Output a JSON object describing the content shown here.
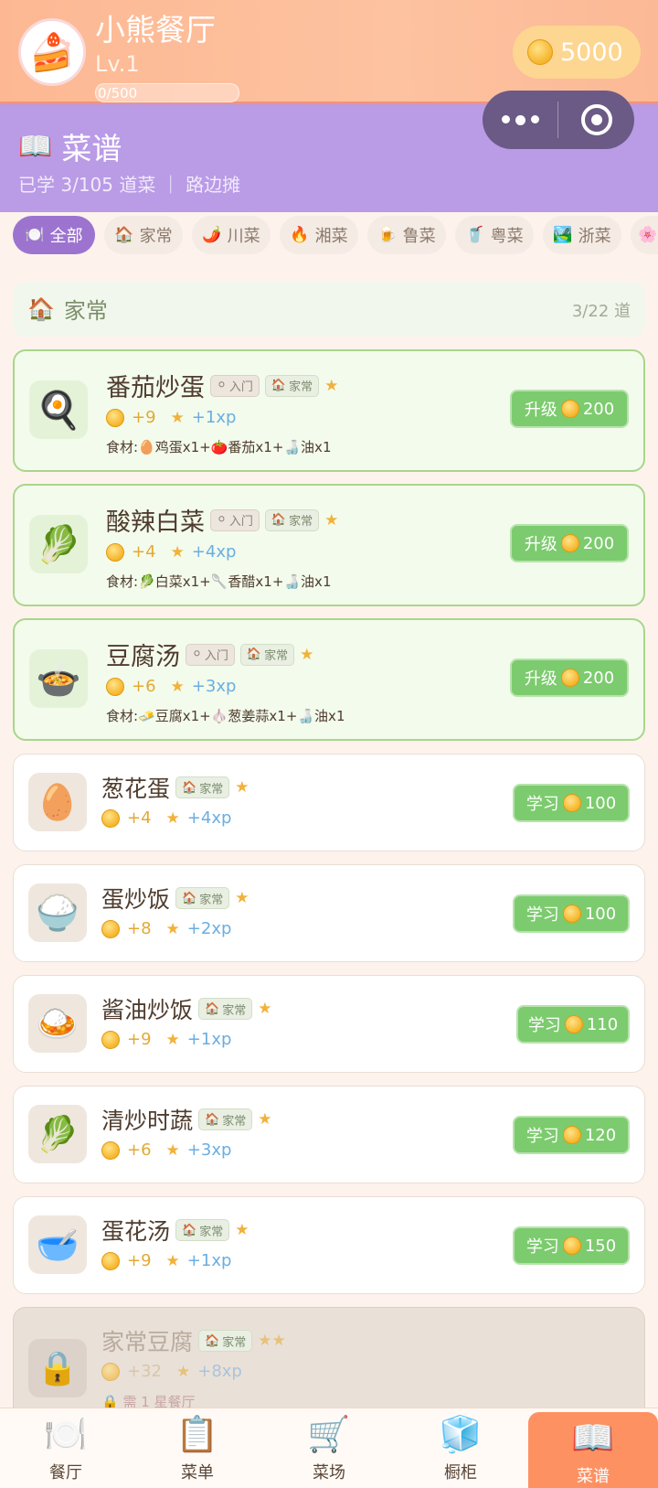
{
  "header": {
    "shop_name": "小熊餐厅",
    "level": "Lv.1",
    "exp_text": "0/500",
    "exp_progress": 0,
    "coins": "5000",
    "avatar_icon": "cake-icon"
  },
  "recipe_book": {
    "icon": "📖",
    "title": "菜谱",
    "subtitle": "已学 3/105 道菜 ｜ 路边摊"
  },
  "tabs": [
    {
      "emoji": "🍽️",
      "label": "全部",
      "active": true
    },
    {
      "emoji": "🏠",
      "label": "家常"
    },
    {
      "emoji": "🌶️",
      "label": "川菜"
    },
    {
      "emoji": "🔥",
      "label": "湘菜"
    },
    {
      "emoji": "🍺",
      "label": "鲁菜"
    },
    {
      "emoji": "🥤",
      "label": "粤菜"
    },
    {
      "emoji": "🏞️",
      "label": "浙菜"
    },
    {
      "emoji": "🌸",
      "label": ""
    }
  ],
  "section": {
    "icon": "🏠",
    "title": "家常",
    "count": "3/22 道"
  },
  "learned": [
    {
      "icon": "🍳",
      "name": "番茄炒蛋",
      "level_badge": "入门",
      "cuisine_badge": "家常",
      "stars": "★",
      "coin": "+9",
      "xp": "+1xp",
      "ingredients": "食材:🥚鸡蛋x1+🍅番茄x1+🍶油x1",
      "action": "升级",
      "cost": "200"
    },
    {
      "icon": "🥬",
      "name": "酸辣白菜",
      "level_badge": "入门",
      "cuisine_badge": "家常",
      "stars": "★",
      "coin": "+4",
      "xp": "+4xp",
      "ingredients": "食材:🥬白菜x1+🥄香醋x1+🍶油x1",
      "action": "升级",
      "cost": "200"
    },
    {
      "icon": "🍲",
      "name": "豆腐汤",
      "level_badge": "入门",
      "cuisine_badge": "家常",
      "stars": "★",
      "coin": "+6",
      "xp": "+3xp",
      "ingredients": "食材:🧈豆腐x1+🧄葱姜蒜x1+🍶油x1",
      "action": "升级",
      "cost": "200"
    }
  ],
  "unlearned": [
    {
      "icon": "🥚",
      "name": "葱花蛋",
      "cuisine_badge": "家常",
      "stars": "★",
      "coin": "+4",
      "xp": "+4xp",
      "action": "学习",
      "cost": "100"
    },
    {
      "icon": "🍚",
      "name": "蛋炒饭",
      "cuisine_badge": "家常",
      "stars": "★",
      "coin": "+8",
      "xp": "+2xp",
      "action": "学习",
      "cost": "100"
    },
    {
      "icon": "🍛",
      "name": "酱油炒饭",
      "cuisine_badge": "家常",
      "stars": "★",
      "coin": "+9",
      "xp": "+1xp",
      "action": "学习",
      "cost": "110"
    },
    {
      "icon": "🥬",
      "name": "清炒时蔬",
      "cuisine_badge": "家常",
      "stars": "★",
      "coin": "+6",
      "xp": "+3xp",
      "action": "学习",
      "cost": "120"
    },
    {
      "icon": "🥣",
      "name": "蛋花汤",
      "cuisine_badge": "家常",
      "stars": "★",
      "coin": "+9",
      "xp": "+1xp",
      "action": "学习",
      "cost": "150"
    }
  ],
  "locked": {
    "icon": "🔒",
    "name": "家常豆腐",
    "cuisine_badge": "家常",
    "stars": "★★",
    "coin": "+32",
    "xp": "+8xp",
    "requirement": "🔒 需 1 星餐厅"
  },
  "nav": [
    {
      "icon": "🍽️",
      "label": "餐厅"
    },
    {
      "icon": "📋",
      "label": "菜单"
    },
    {
      "icon": "🛒",
      "label": "菜场"
    },
    {
      "icon": "🧊",
      "label": "橱柜"
    },
    {
      "icon": "📖",
      "label": "菜谱",
      "active": true
    }
  ]
}
